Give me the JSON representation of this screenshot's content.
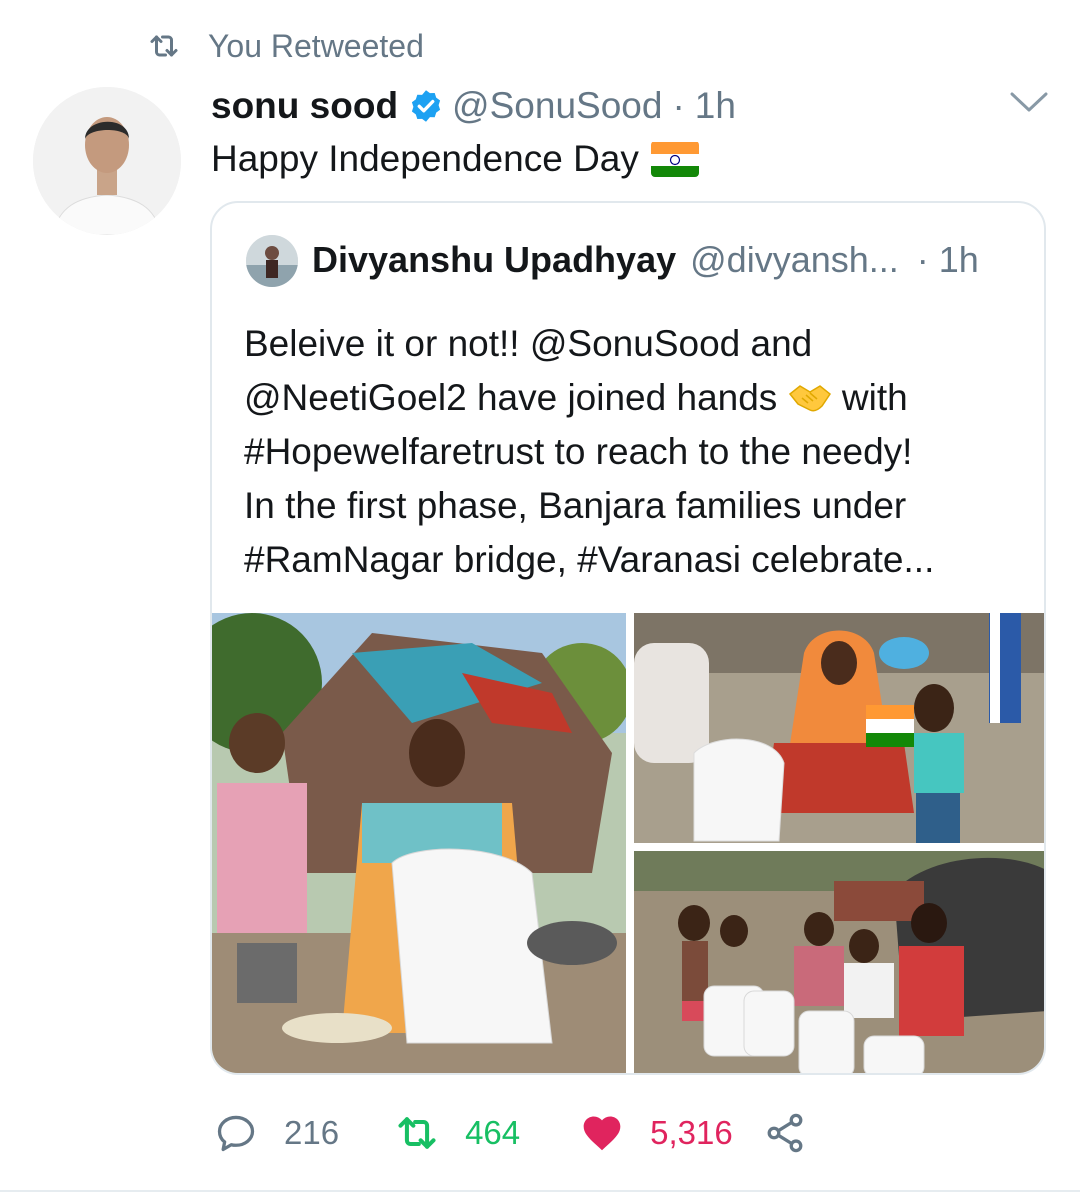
{
  "retweet_context": {
    "label": "You Retweeted",
    "icon": "retweet-icon"
  },
  "tweet": {
    "author_name": "sonu sood",
    "author_handle": "@SonuSood",
    "separator": "·",
    "time": "1h",
    "verified": true,
    "text": "Happy Independence Day",
    "emoji": "india-flag"
  },
  "quoted_tweet": {
    "author_name": "Divyanshu Upadhyay",
    "author_handle": "@divyansh...",
    "separator": "·",
    "time": "1h",
    "lines": [
      {
        "before": "Beleive it or not!!  @SonuSood and",
        "emoji": "",
        "after": ""
      },
      {
        "before": "@NeetiGoel2 have joined hands ",
        "emoji": "handshake",
        "after": " with"
      },
      {
        "before": "#Hopewelfaretrust to reach to the needy!",
        "emoji": "",
        "after": ""
      },
      {
        "before": "In the first phase, Banjara families under",
        "emoji": "",
        "after": ""
      },
      {
        "before": "#RamNagar bridge, #Varanasi celebrate...",
        "emoji": "",
        "after": ""
      }
    ],
    "photos": [
      "photo-mother-children-tent",
      "photo-woman-child-flag",
      "photo-group-families"
    ]
  },
  "actions": {
    "replies": "216",
    "retweets": "464",
    "likes": "5,316"
  },
  "colors": {
    "secondary_text": "#657786",
    "retweet_green": "#17bf63",
    "like_red": "#e0245e",
    "verified_blue": "#1da1f2",
    "border": "#e1e8ed"
  }
}
